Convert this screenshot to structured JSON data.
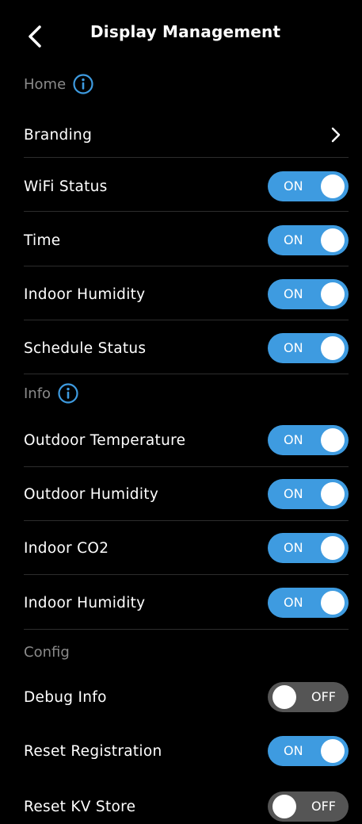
{
  "header": {
    "title": "Display Management",
    "back_icon": "chevron-left-icon"
  },
  "sections": {
    "home": {
      "label": "Home",
      "info_icon": "info-icon",
      "branding_label": "Branding",
      "branding_icon": "chevron-right-icon",
      "items": [
        {
          "label": "WiFi Status",
          "state": "ON"
        },
        {
          "label": "Time",
          "state": "ON"
        },
        {
          "label": "Indoor Humidity",
          "state": "ON"
        },
        {
          "label": "Schedule Status",
          "state": "ON"
        }
      ]
    },
    "info": {
      "label": "Info",
      "info_icon": "info-icon",
      "items": [
        {
          "label": "Outdoor Temperature",
          "state": "ON"
        },
        {
          "label": "Outdoor Humidity",
          "state": "ON"
        },
        {
          "label": "Indoor CO2",
          "state": "ON"
        },
        {
          "label": "Indoor Humidity",
          "state": "ON"
        }
      ]
    },
    "config": {
      "label": "Config",
      "items": [
        {
          "label": "Debug Info",
          "state": "OFF"
        },
        {
          "label": "Reset Registration",
          "state": "ON"
        },
        {
          "label": "Reset KV Store",
          "state": "OFF"
        }
      ]
    }
  },
  "colors": {
    "background": "#000000",
    "toggle_on": "#3e9be0",
    "toggle_off": "#555555",
    "section_label": "#8a8a8a",
    "info_icon": "#3e9be0"
  }
}
